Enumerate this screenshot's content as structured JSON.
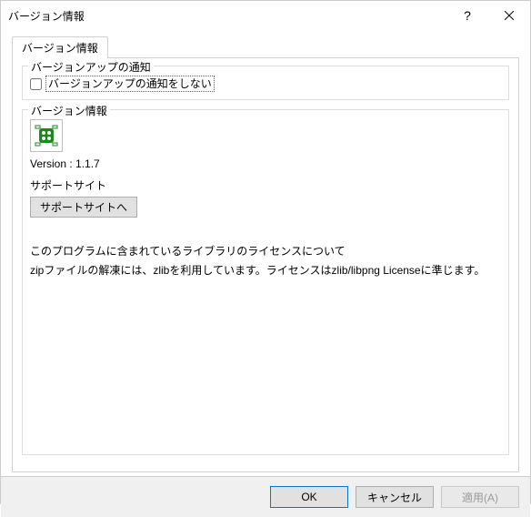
{
  "window": {
    "title": "バージョン情報"
  },
  "tabs": {
    "main_label": "バージョン情報"
  },
  "group_notify": {
    "legend": "バージョンアップの通知",
    "checkbox_label": "バージョンアップの通知をしない",
    "checkbox_checked": false
  },
  "group_version": {
    "legend": "バージョン情報",
    "version_text": "Version : 1.1.7",
    "support_label": "サポートサイト",
    "support_button": "サポートサイトへ",
    "license_heading": "このプログラムに含まれているライブラリのライセンスについて",
    "license_body": "zipファイルの解凍には、zlibを利用しています。ライセンスはzlib/libpng Licenseに準じます。"
  },
  "buttons": {
    "ok": "OK",
    "cancel": "キャンセル",
    "apply": "適用(A)"
  }
}
